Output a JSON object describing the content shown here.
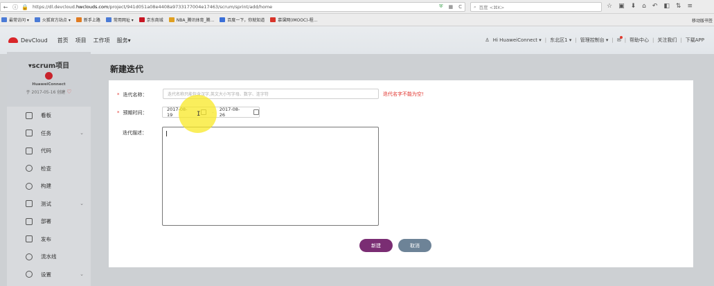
{
  "browser": {
    "url_prefix": "https://dl.devcloud.",
    "url_domain": "hwclouds.com",
    "url_path": "/project/941d051a08e4408a9733177004e17463/scrum/sprint/add/home",
    "search_placeholder": "百度 <⌘K>",
    "bookmarks": [
      {
        "label": "最常访问 ▾",
        "color": "#4b7bd6"
      },
      {
        "label": "火狐官方站点 ▾",
        "color": "#4b7bd6"
      },
      {
        "label": "新手上路",
        "color": "#e07b20"
      },
      {
        "label": "常用网址 ▾",
        "color": "#4b7bd6"
      },
      {
        "label": "京东商城",
        "color": "#c81623"
      },
      {
        "label": "NBA_腾讯体育_腾...",
        "color": "#e0a020"
      },
      {
        "label": "百度一下，你就知道",
        "color": "#3a6fd8"
      },
      {
        "label": "慕课网(IMOOC)-程...",
        "color": "#d8342a"
      }
    ],
    "mobile_bookmarks": "移动版书签"
  },
  "header": {
    "brand": "DevCloud",
    "nav": [
      "首页",
      "项目",
      "工作项",
      "服务▾"
    ],
    "user": "Hi HuaweiConnect ▾",
    "region": "东北区1 ▾",
    "console": "管理控制台 ▾",
    "help": "帮助中心",
    "about": "关注我们",
    "download": "下载APP"
  },
  "sidebar": {
    "project_title": "▾scrum项目",
    "org": "HuaweiConnect",
    "created": "于 2017-05-16 创建",
    "items": [
      {
        "label": "看板",
        "icon": "board-icon",
        "chevron": false
      },
      {
        "label": "任务",
        "icon": "task-icon",
        "chevron": true
      },
      {
        "label": "代码",
        "icon": "code-icon",
        "chevron": false
      },
      {
        "label": "检查",
        "icon": "check-icon",
        "chevron": false
      },
      {
        "label": "构建",
        "icon": "build-icon",
        "chevron": false
      },
      {
        "label": "测试",
        "icon": "test-icon",
        "chevron": true
      },
      {
        "label": "部署",
        "icon": "deploy-icon",
        "chevron": false
      },
      {
        "label": "发布",
        "icon": "release-icon",
        "chevron": false
      },
      {
        "label": "流水线",
        "icon": "pipeline-icon",
        "chevron": false
      },
      {
        "label": "设置",
        "icon": "settings-icon",
        "chevron": true
      }
    ]
  },
  "form": {
    "title": "新建迭代",
    "name_label": "迭代名称：",
    "name_placeholder": "迭代名称只能包含汉字,英文大小写字母、数字、连字符",
    "name_error": "迭代名字不能为空!",
    "period_label": "预期时间：",
    "start_date": "2017-08-19",
    "date_separator": "-",
    "end_date": "2017-08-26",
    "desc_label": "迭代描述：",
    "create_button": "新建",
    "cancel_button": "取消"
  }
}
